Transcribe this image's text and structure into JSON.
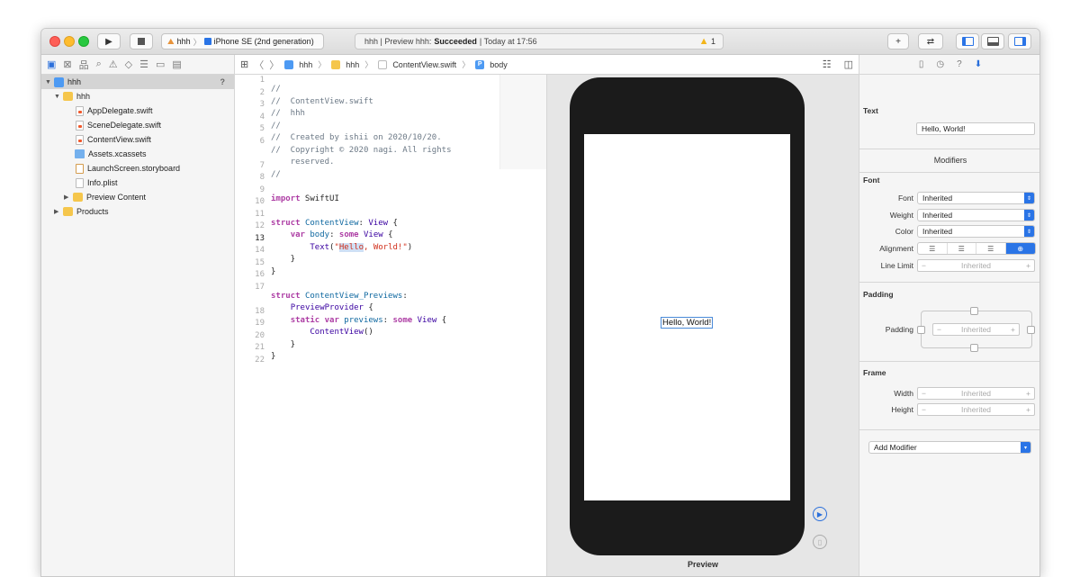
{
  "titlebar": {
    "scheme_project": "hhh",
    "scheme_device": "iPhone SE (2nd generation)",
    "status_prefix": "hhh | Preview hhh:",
    "status_result": "Succeeded",
    "status_time": "| Today at 17:56",
    "warning_count": "1"
  },
  "navigator": {
    "help": "?",
    "items": [
      {
        "label": "hhh",
        "kind": "project"
      },
      {
        "label": "hhh",
        "kind": "folder"
      },
      {
        "label": "AppDelegate.swift",
        "kind": "swift"
      },
      {
        "label": "SceneDelegate.swift",
        "kind": "swift"
      },
      {
        "label": "ContentView.swift",
        "kind": "swift"
      },
      {
        "label": "Assets.xcassets",
        "kind": "assets"
      },
      {
        "label": "LaunchScreen.storyboard",
        "kind": "storyboard"
      },
      {
        "label": "Info.plist",
        "kind": "plist"
      },
      {
        "label": "Preview Content",
        "kind": "folder"
      },
      {
        "label": "Products",
        "kind": "folder"
      }
    ]
  },
  "jumpbar": {
    "project": "hhh",
    "group": "hhh",
    "file": "ContentView.swift",
    "symbol_badge": "P",
    "symbol": "body"
  },
  "code": {
    "line_numbers": [
      "1",
      "2",
      "3",
      "4",
      "5",
      "6",
      "",
      "7",
      "8",
      "9",
      "10",
      "11",
      "12",
      "13",
      "14",
      "15",
      "16",
      "17",
      "",
      "18",
      "19",
      "20",
      "21",
      "22"
    ]
  },
  "canvas": {
    "preview_text": "Hello, World!",
    "preview_label": "Preview"
  },
  "inspector": {
    "text_section": "Text",
    "text_value": "Hello, World!",
    "modifiers_title": "Modifiers",
    "font_section": "Font",
    "font_label": "Font",
    "font_value": "Inherited",
    "weight_label": "Weight",
    "weight_value": "Inherited",
    "color_label": "Color",
    "color_value": "Inherited",
    "alignment_label": "Alignment",
    "line_limit_label": "Line Limit",
    "line_limit_value": "Inherited",
    "padding_section": "Padding",
    "padding_label": "Padding",
    "padding_value": "Inherited",
    "frame_section": "Frame",
    "width_label": "Width",
    "width_value": "Inherited",
    "height_label": "Height",
    "height_value": "Inherited",
    "add_modifier": "Add Modifier",
    "stepper_minus": "−",
    "stepper_plus": "+"
  },
  "colors": {
    "accent": "#2a74e6",
    "keyword": "#ad3da4",
    "comment": "#6c7986",
    "string": "#d12f1b"
  }
}
